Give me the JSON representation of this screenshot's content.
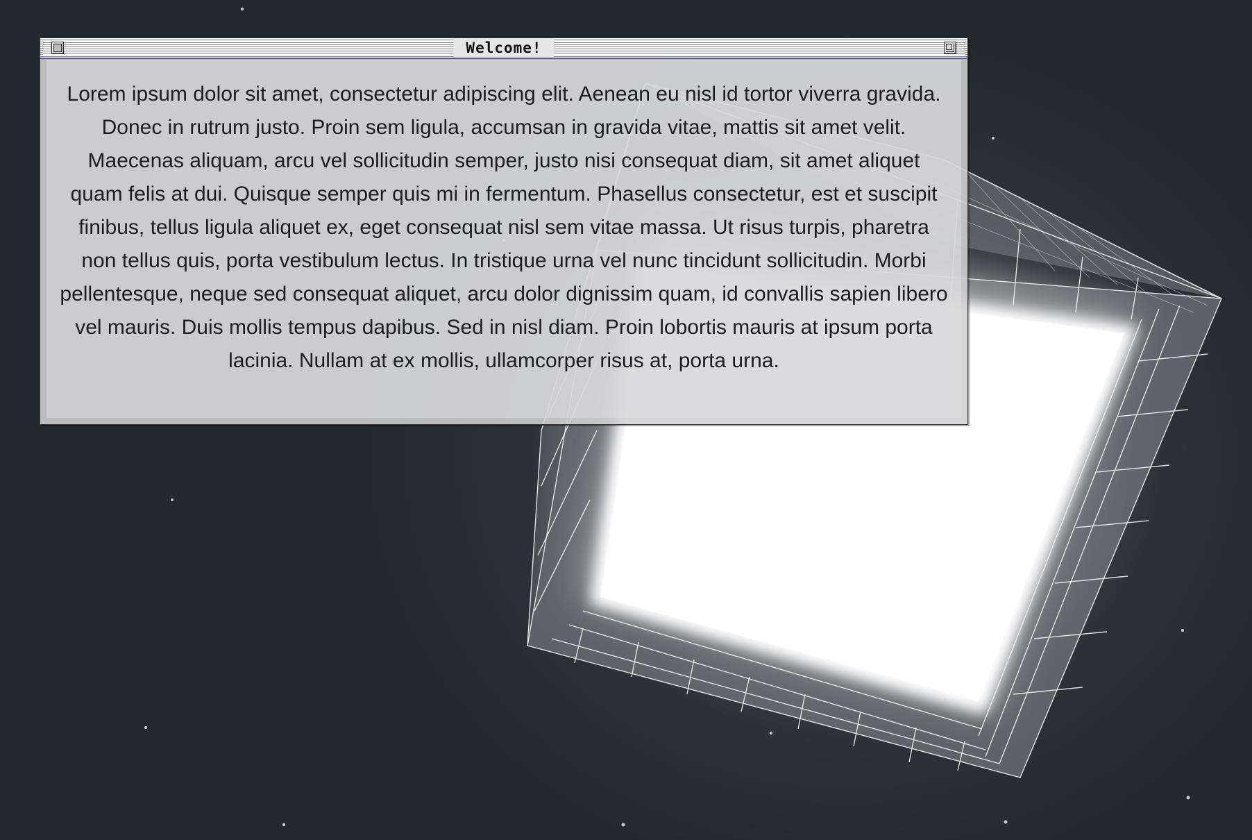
{
  "window": {
    "title": "Welcome!",
    "close_icon": "close-box-icon",
    "zoom_icon": "zoom-box-icon"
  },
  "content": {
    "paragraph": "Lorem ipsum dolor sit amet, consectetur adipiscing elit. Aenean eu nisl id tortor viverra gravida. Donec in rutrum justo. Proin sem ligula, accumsan in gravida vitae, mattis sit amet velit. Maecenas aliquam, arcu vel sollicitudin semper, justo nisi consequat diam, sit amet aliquet quam felis at dui. Quisque semper quis mi in fermentum. Phasellus consectetur, est et suscipit finibus, tellus ligula aliquet ex, eget consequat nisl sem vitae massa. Ut risus turpis, pharetra non tellus quis, porta vestibulum lectus. In tristique urna vel nunc tincidunt sollicitudin. Morbi pellentesque, neque sed consequat aliquet, arcu dolor dignissim quam, id convallis sapien libero vel mauris. Duis mollis tempus dapibus. Sed in nisl diam. Proin lobortis mauris at ipsum porta lacinia. Nullam at ex mollis, ullamcorper risus at, porta urna."
  },
  "background": {
    "base_color": "#24272c",
    "glow_color": "#ffffff"
  }
}
